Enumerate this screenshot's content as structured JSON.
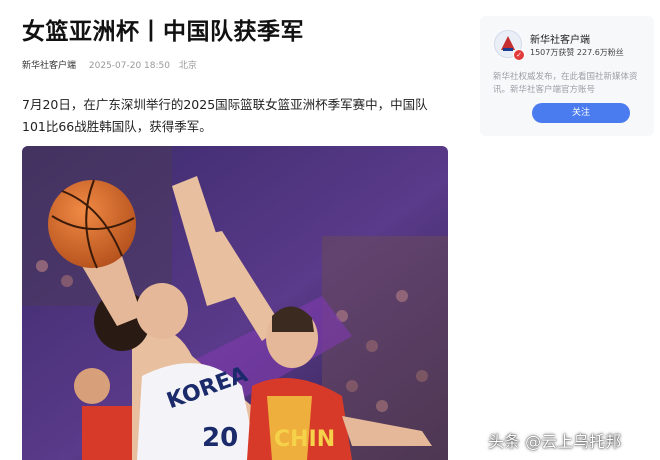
{
  "article": {
    "title": "女篮亚洲杯丨中国队获季军",
    "source": "新华社客户端",
    "time": "2025-07-20 18:50",
    "location": "北京",
    "body": "7月20日，在广东深圳举行的2025国际篮联女篮亚洲杯季军赛中，中国队101比66战胜韩国队，获得季军。"
  },
  "photo": {
    "jersey_korea_text": "KOREA",
    "jersey_korea_number": "20",
    "jersey_china_text": "CHIN"
  },
  "watermark": "头条 @云上乌托邦",
  "sidebar": {
    "account_name": "新华社客户端",
    "stats": "1507万获赞  227.6万粉丝",
    "description": "新华社权威发布，在此看国社新媒体资讯。新华社客户端官方账号",
    "follow_label": "关注"
  },
  "colors": {
    "accent": "#4a7bef",
    "card_bg": "#f7f8fa",
    "korea_jersey": "#f4f4f8",
    "china_jersey": "#d83a2a"
  }
}
